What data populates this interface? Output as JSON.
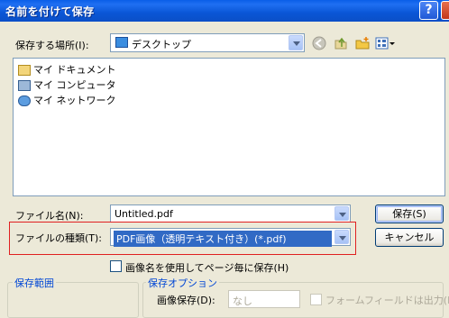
{
  "window": {
    "title": "名前を付けて保存",
    "help_label": "?"
  },
  "location": {
    "label": "保存する場所(I):",
    "value": "デスクトップ"
  },
  "file_list": [
    {
      "label": "マイ ドキュメント",
      "icon": "my-documents-icon"
    },
    {
      "label": "マイ コンピュータ",
      "icon": "my-computer-icon"
    },
    {
      "label": "マイ ネットワーク",
      "icon": "my-network-icon"
    }
  ],
  "filename": {
    "label": "ファイル名(N):",
    "value": "Untitled.pdf"
  },
  "filetype": {
    "label": "ファイルの種類(T):",
    "value": "PDF画像（透明テキスト付き）(*.pdf)"
  },
  "buttons": {
    "save": "保存(S)",
    "cancel": "キャンセル"
  },
  "options": {
    "save_per_page_label": "画像名を使用してページ毎に保存(H)"
  },
  "groups": {
    "save_range_title": "保存範囲",
    "save_options_title": "保存オプション",
    "image_save_label": "画像保存(D):",
    "image_save_value": "なし",
    "form_field_label": "フォームフィールドは出力(E)"
  },
  "colors": {
    "title_bar": "#0a56d6",
    "dialog_bg": "#ece9d8",
    "selection": "#316ac5",
    "highlight_border": "#e02020"
  }
}
